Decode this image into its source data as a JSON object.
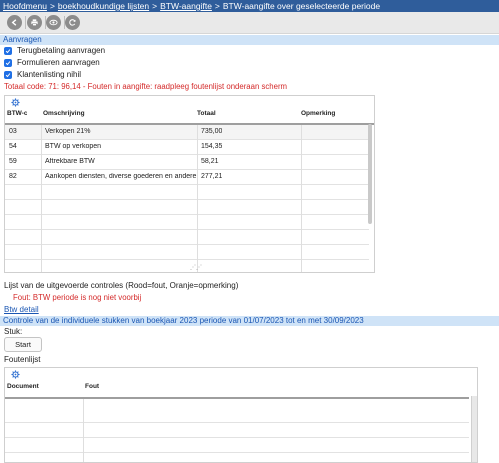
{
  "breadcrumb": {
    "items": [
      "Hoofdmenu",
      "boekhoudkundige lijsten",
      "BTW-aangifte"
    ],
    "current": "BTW-aangifte over geselecteerde periode",
    "separator": ">"
  },
  "toolbar": {
    "buttons": [
      "back-icon",
      "print-icon",
      "view-icon",
      "refresh-icon"
    ]
  },
  "aanvragen": {
    "header": "Aanvragen",
    "checkboxes": [
      {
        "label": "Terugbetaling aanvragen",
        "checked": true
      },
      {
        "label": "Formulieren aanvragen",
        "checked": true
      },
      {
        "label": "Klantenlisting nihil",
        "checked": true
      }
    ],
    "error_line": "Totaal code: 71: 96,14 - Fouten in aangifte: raadpleeg foutenlijst onderaan scherm"
  },
  "btw_grid": {
    "columns": [
      "BTW-c",
      "Omschrijving",
      "Totaal",
      "Opmerking"
    ],
    "rows": [
      {
        "code": "03",
        "omschrijving": "Verkopen 21%",
        "totaal": "735,00",
        "opmerking": ""
      },
      {
        "code": "54",
        "omschrijving": "BTW op verkopen",
        "totaal": "154,35",
        "opmerking": ""
      },
      {
        "code": "59",
        "omschrijving": "Aftrekbare BTW",
        "totaal": "58,21",
        "opmerking": ""
      },
      {
        "code": "82",
        "omschrijving": "Aankopen diensten, diverse goederen en andere",
        "totaal": "277,21",
        "opmerking": ""
      }
    ]
  },
  "controles": {
    "title": "Lijst van de uitgevoerde controles (Rood=fout, Oranje=opmerking)",
    "items": [
      "Fout: BTW periode is nog niet voorbij"
    ],
    "detail_link": "Btw detail"
  },
  "controle_stukken": {
    "header": "Controle van de individuele stukken van boekjaar 2023 periode van 01/07/2023 tot en met 30/09/2023",
    "stuk_label": "Stuk:",
    "start_label": "Start",
    "foutenlijst_label": "Foutenlijst"
  },
  "fouten_grid": {
    "columns": [
      "Document",
      "Fout"
    ]
  },
  "colors": {
    "topbar": "#2f5d9b",
    "section_bar": "#cfe3f7",
    "accent": "#1a56b3",
    "error": "#d42a2a",
    "checkbox": "#1f6fe5"
  }
}
